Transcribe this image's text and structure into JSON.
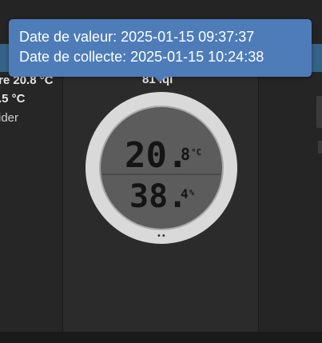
{
  "tooltip": {
    "value_date": "Date de valeur: 2025-01-15 09:37:37",
    "collect_date": "Date de collecte: 2025-01-15 10:24:38"
  },
  "left_panel": {
    "line1": "re 20.8 °C",
    "line2": ".5 °C",
    "line3": "ider"
  },
  "center_panel": {
    "device_title": "81 lqi"
  },
  "thermometer": {
    "temperature_integer": "20.",
    "temperature_decimal": "8",
    "temperature_unit": "°C",
    "humidity_integer": "38.",
    "humidity_decimal": "4",
    "humidity_unit": "%",
    "indicator": "••"
  },
  "colors": {
    "tooltip_bg": "#4e7cb8",
    "accent_band": "#3a78a8",
    "bezel": "#d9d9d9",
    "screen": "#5c5c5c"
  }
}
